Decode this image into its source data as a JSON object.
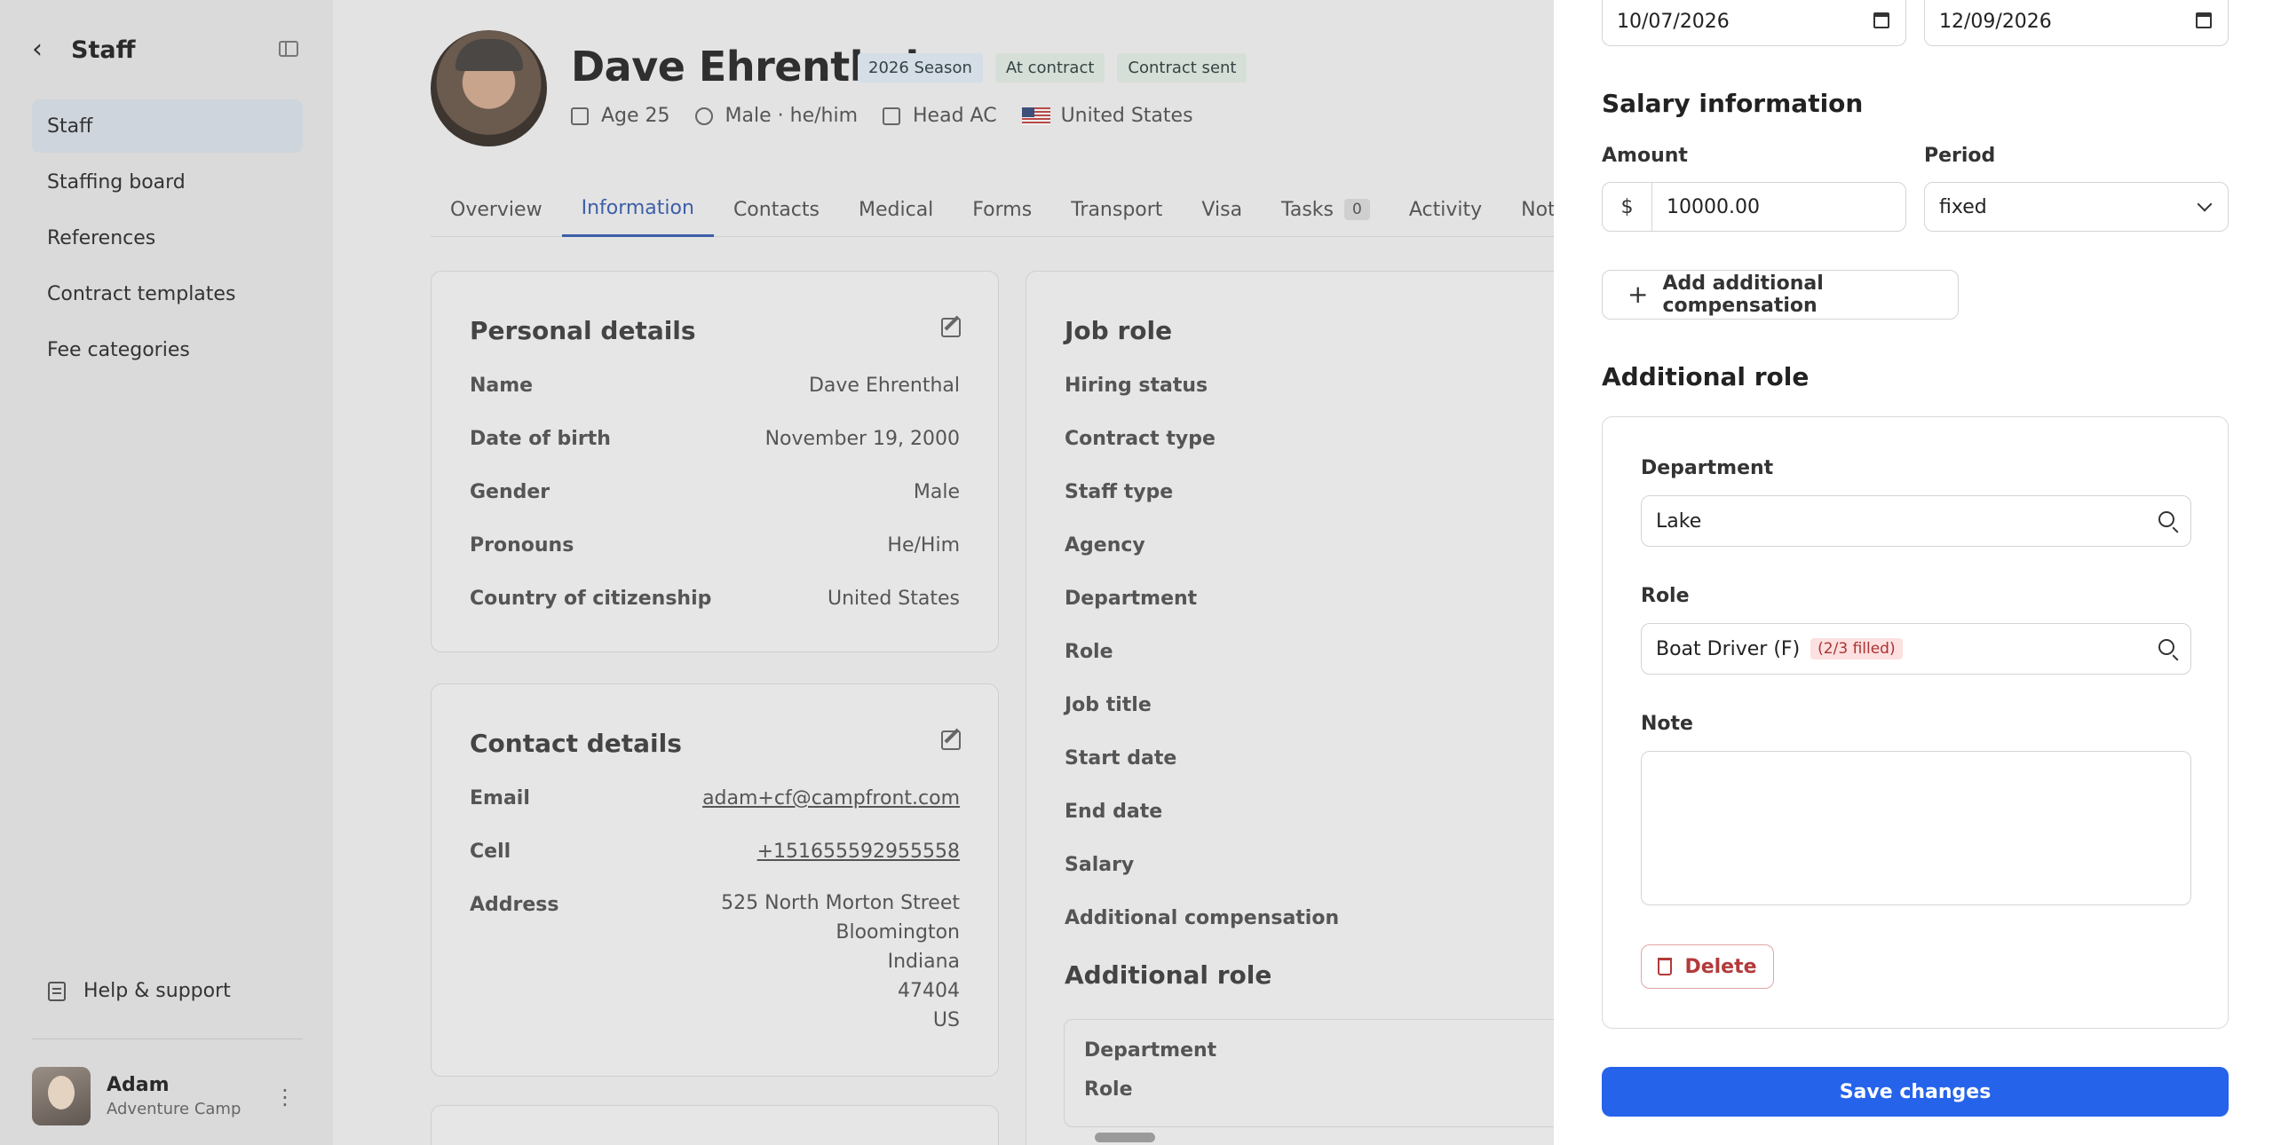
{
  "sidebar": {
    "title": "Staff",
    "items": [
      {
        "label": "Staff"
      },
      {
        "label": "Staffing board"
      },
      {
        "label": "References"
      },
      {
        "label": "Contract templates"
      },
      {
        "label": "Fee categories"
      }
    ],
    "help_label": "Help & support",
    "user": {
      "name": "Adam",
      "org": "Adventure Camp"
    }
  },
  "profile": {
    "name": "Dave Ehrenthal",
    "badges": [
      "2026 Season",
      "At contract",
      "Contract sent"
    ],
    "age": "Age 25",
    "gender": "Male · he/him",
    "position": "Head AC",
    "country": "United States"
  },
  "tabs": [
    {
      "label": "Overview"
    },
    {
      "label": "Information"
    },
    {
      "label": "Contacts"
    },
    {
      "label": "Medical"
    },
    {
      "label": "Forms"
    },
    {
      "label": "Transport"
    },
    {
      "label": "Visa"
    },
    {
      "label": "Tasks",
      "count": "0"
    },
    {
      "label": "Activity"
    },
    {
      "label": "Notes"
    }
  ],
  "personal": {
    "title": "Personal details",
    "rows": [
      {
        "label": "Name",
        "value": "Dave Ehrenthal"
      },
      {
        "label": "Date of birth",
        "value": "November 19, 2000"
      },
      {
        "label": "Gender",
        "value": "Male"
      },
      {
        "label": "Pronouns",
        "value": "He/Him"
      },
      {
        "label": "Country of citizenship",
        "value": "United States"
      }
    ]
  },
  "contact": {
    "title": "Contact details",
    "email_label": "Email",
    "email": "adam+cf@campfront.com",
    "cell_label": "Cell",
    "cell": "+151655592955558",
    "address_label": "Address",
    "address": [
      "525 North Morton Street",
      "Bloomington",
      "Indiana",
      "47404",
      "US"
    ]
  },
  "job": {
    "title": "Job role",
    "rows": [
      "Hiring status",
      "Contract type",
      "Staff type",
      "Agency",
      "Department",
      "Role",
      "Job title",
      "Start date",
      "End date",
      "Salary",
      "Additional compensation"
    ],
    "additional_title": "Additional role",
    "sub_rows": [
      "Department",
      "Role"
    ]
  },
  "panel": {
    "start_date": "10/07/2026",
    "end_date": "12/09/2026",
    "salary_title": "Salary information",
    "amount_label": "Amount",
    "currency": "$",
    "amount": "10000.00",
    "period_label": "Period",
    "period": "fixed",
    "add_comp_label": "Add additional compensation",
    "additional_role_title": "Additional role",
    "department_label": "Department",
    "department": "Lake",
    "role_label": "Role",
    "role": "Boat Driver (F)",
    "role_filled": "(2/3 filled)",
    "note_label": "Note",
    "delete_label": "Delete",
    "save_label": "Save changes"
  }
}
